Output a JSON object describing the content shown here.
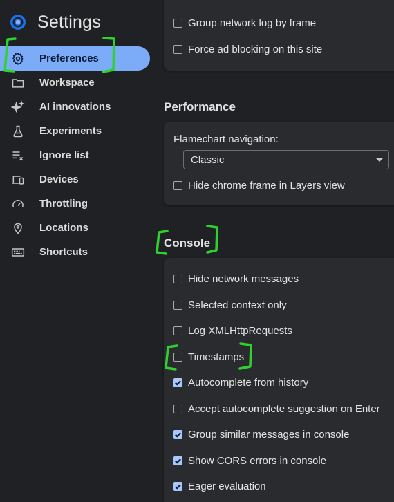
{
  "app": {
    "title": "Settings"
  },
  "sidebar": {
    "items": [
      {
        "label": "Preferences",
        "icon": "gear-icon",
        "active": true
      },
      {
        "label": "Workspace",
        "icon": "folder-icon"
      },
      {
        "label": "AI innovations",
        "icon": "sparkle-icon"
      },
      {
        "label": "Experiments",
        "icon": "flask-icon"
      },
      {
        "label": "Ignore list",
        "icon": "ignore-list-icon"
      },
      {
        "label": "Devices",
        "icon": "devices-icon"
      },
      {
        "label": "Throttling",
        "icon": "gauge-icon"
      },
      {
        "label": "Locations",
        "icon": "location-pin-icon"
      },
      {
        "label": "Shortcuts",
        "icon": "keyboard-icon"
      }
    ]
  },
  "main": {
    "top_card": {
      "options": [
        {
          "label": "Group network log by frame",
          "checked": false
        },
        {
          "label": "Force ad blocking on this site",
          "checked": false
        }
      ]
    },
    "performance": {
      "title": "Performance",
      "flamechart_label": "Flamechart navigation:",
      "flamechart_value": "Classic",
      "options": [
        {
          "label": "Hide chrome frame in Layers view",
          "checked": false
        }
      ]
    },
    "console": {
      "title": "Console",
      "options": [
        {
          "label": "Hide network messages",
          "checked": false
        },
        {
          "label": "Selected context only",
          "checked": false
        },
        {
          "label": "Log XMLHttpRequests",
          "checked": false
        },
        {
          "label": "Timestamps",
          "checked": false
        },
        {
          "label": "Autocomplete from history",
          "checked": true
        },
        {
          "label": "Accept autocomplete suggestion on Enter",
          "checked": false
        },
        {
          "label": "Group similar messages in console",
          "checked": true
        },
        {
          "label": "Show CORS errors in console",
          "checked": true
        },
        {
          "label": "Eager evaluation",
          "checked": true
        }
      ]
    }
  },
  "colors": {
    "background": "#202124",
    "card": "#2a2b2e",
    "active_nav": "#7cacf8",
    "checkbox_checked": "#a8c7fa",
    "annotation": "#2fd12f"
  }
}
